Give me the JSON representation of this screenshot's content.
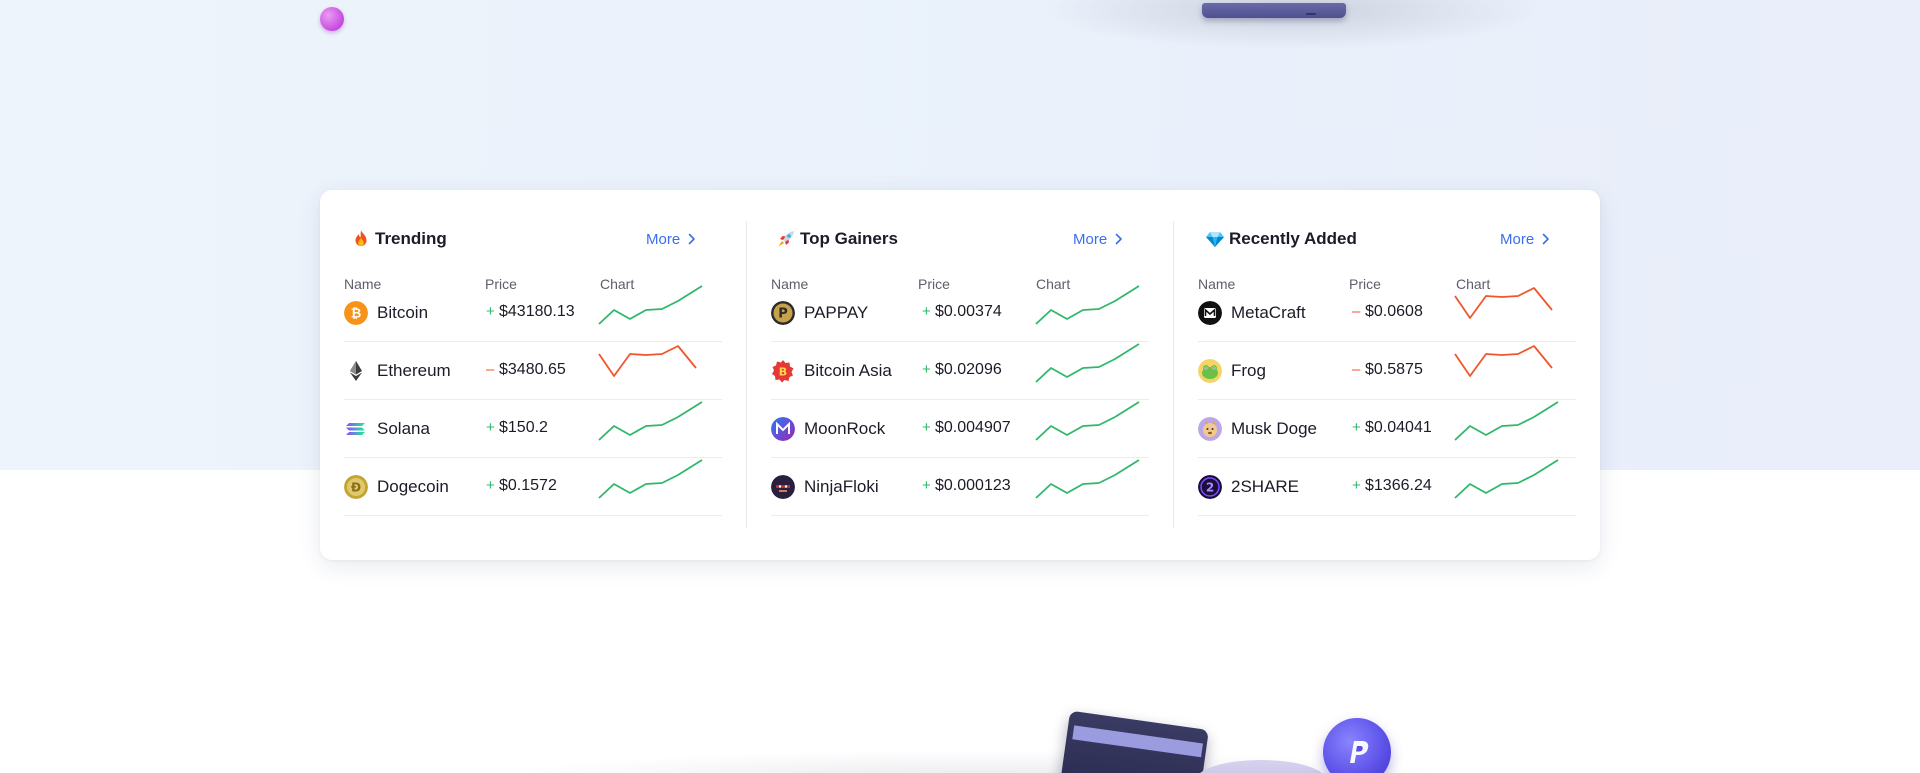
{
  "sections": [
    {
      "title": "Trending",
      "emoji": "fire-icon",
      "more_label": "More",
      "columns": {
        "name": "Name",
        "price": "Price",
        "chart": "Chart"
      },
      "rows": [
        {
          "name": "Bitcoin",
          "price": "$43180.13",
          "trend": "up",
          "icon": "bitcoin-icon",
          "color": "#f7931a"
        },
        {
          "name": "Ethereum",
          "price": "$3480.65",
          "trend": "down",
          "icon": "ethereum-icon",
          "color": "#3c3c3d"
        },
        {
          "name": "Solana",
          "price": "$150.2",
          "trend": "up",
          "icon": "solana-icon",
          "color": "#9945ff"
        },
        {
          "name": "Dogecoin",
          "price": "$0.1572",
          "trend": "up",
          "icon": "dogecoin-icon",
          "color": "#c2a633"
        }
      ]
    },
    {
      "title": "Top Gainers",
      "emoji": "rocket-icon",
      "more_label": "More",
      "columns": {
        "name": "Name",
        "price": "Price",
        "chart": "Chart"
      },
      "rows": [
        {
          "name": "PAPPAY",
          "price": "$0.00374",
          "trend": "up",
          "icon": "pappay-icon",
          "color": "#2b2b2b"
        },
        {
          "name": "Bitcoin Asia",
          "price": "$0.02096",
          "trend": "up",
          "icon": "bitcoin-asia-icon",
          "color": "#e53935"
        },
        {
          "name": "MoonRock",
          "price": "$0.004907",
          "trend": "up",
          "icon": "moonrock-icon",
          "color": "#5b2bd8"
        },
        {
          "name": "NinjaFloki",
          "price": "$0.000123",
          "trend": "up",
          "icon": "ninjafloki-icon",
          "color": "#2a1f3d"
        }
      ]
    },
    {
      "title": "Recently Added",
      "emoji": "diamond-icon",
      "more_label": "More",
      "columns": {
        "name": "Name",
        "price": "Price",
        "chart": "Chart"
      },
      "rows": [
        {
          "name": "MetaCraft",
          "price": "$0.0608",
          "trend": "down",
          "icon": "metacraft-icon",
          "color": "#111111"
        },
        {
          "name": "Frog",
          "price": "$0.5875",
          "trend": "down",
          "icon": "frog-icon",
          "color": "#6cc04a"
        },
        {
          "name": "Musk Doge",
          "price": "$0.04041",
          "trend": "up",
          "icon": "musk-doge-icon",
          "color": "#b9a7e8"
        },
        {
          "name": "2SHARE",
          "price": "$1366.24",
          "trend": "up",
          "icon": "2share-icon",
          "color": "#1a0f3a"
        }
      ]
    }
  ],
  "colors": {
    "up": "#2fb86a",
    "down": "#f0562d",
    "link": "#3a6ef0"
  }
}
